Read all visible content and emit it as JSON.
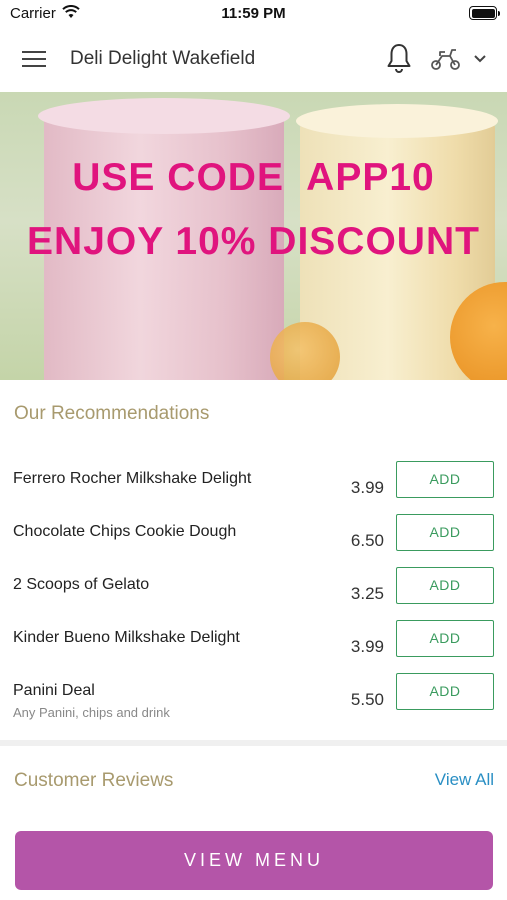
{
  "status_bar": {
    "carrier": "Carrier",
    "time": "11:59 PM",
    "wifi_icon": "wifi-icon",
    "battery_icon": "battery-icon"
  },
  "header": {
    "store_name": "Deli Delight Wakefield",
    "menu_icon": "hamburger-menu-icon",
    "notification_icon": "bell-icon",
    "delivery_icon": "scooter-icon",
    "dropdown_icon": "chevron-down-icon"
  },
  "banner": {
    "line1": "USE CODE  APP10",
    "line2": "ENJOY 10% DISCOUNT",
    "text_color": "#e0147e"
  },
  "recommendations": {
    "title": "Our Recommendations",
    "add_label": "ADD",
    "items": [
      {
        "name": "Ferrero Rocher Milkshake Delight",
        "price": "3.99",
        "description": ""
      },
      {
        "name": "Chocolate Chips Cookie Dough",
        "price": "6.50",
        "description": ""
      },
      {
        "name": "2 Scoops of Gelato",
        "price": "3.25",
        "description": ""
      },
      {
        "name": "Kinder Bueno Milkshake Delight",
        "price": "3.99",
        "description": ""
      },
      {
        "name": "Panini Deal",
        "price": "5.50",
        "description": "Any Panini, chips and drink"
      }
    ]
  },
  "reviews": {
    "title": "Customer Reviews",
    "view_all": "View All"
  },
  "footer": {
    "view_menu": "VIEW MENU"
  },
  "colors": {
    "accent_purple": "#b455a8",
    "add_green": "#3a9b5e",
    "link_blue": "#2a8fc4",
    "section_gold": "#a89a6e"
  }
}
